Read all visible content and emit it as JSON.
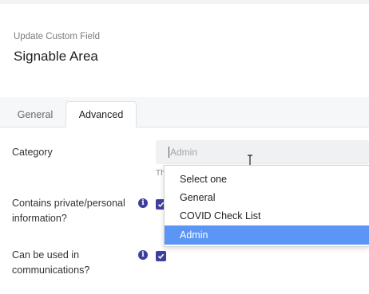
{
  "header": {
    "subtitle": "Update Custom Field",
    "title": "Signable Area"
  },
  "tabs": [
    {
      "label": "General",
      "active": false
    },
    {
      "label": "Advanced",
      "active": true
    }
  ],
  "form": {
    "category": {
      "label": "Category",
      "value": "Admin",
      "helper_text": "Th",
      "options": [
        "Select one",
        "General",
        "COVID Check List",
        "Admin"
      ],
      "highlighted_option": "Admin"
    },
    "private_info": {
      "label": "Contains private/personal information?",
      "checked": true
    },
    "communications": {
      "label": "Can be used in communications?",
      "checked": true
    }
  },
  "colors": {
    "accent": "#3f3e9c",
    "highlight": "#5b95f5"
  }
}
